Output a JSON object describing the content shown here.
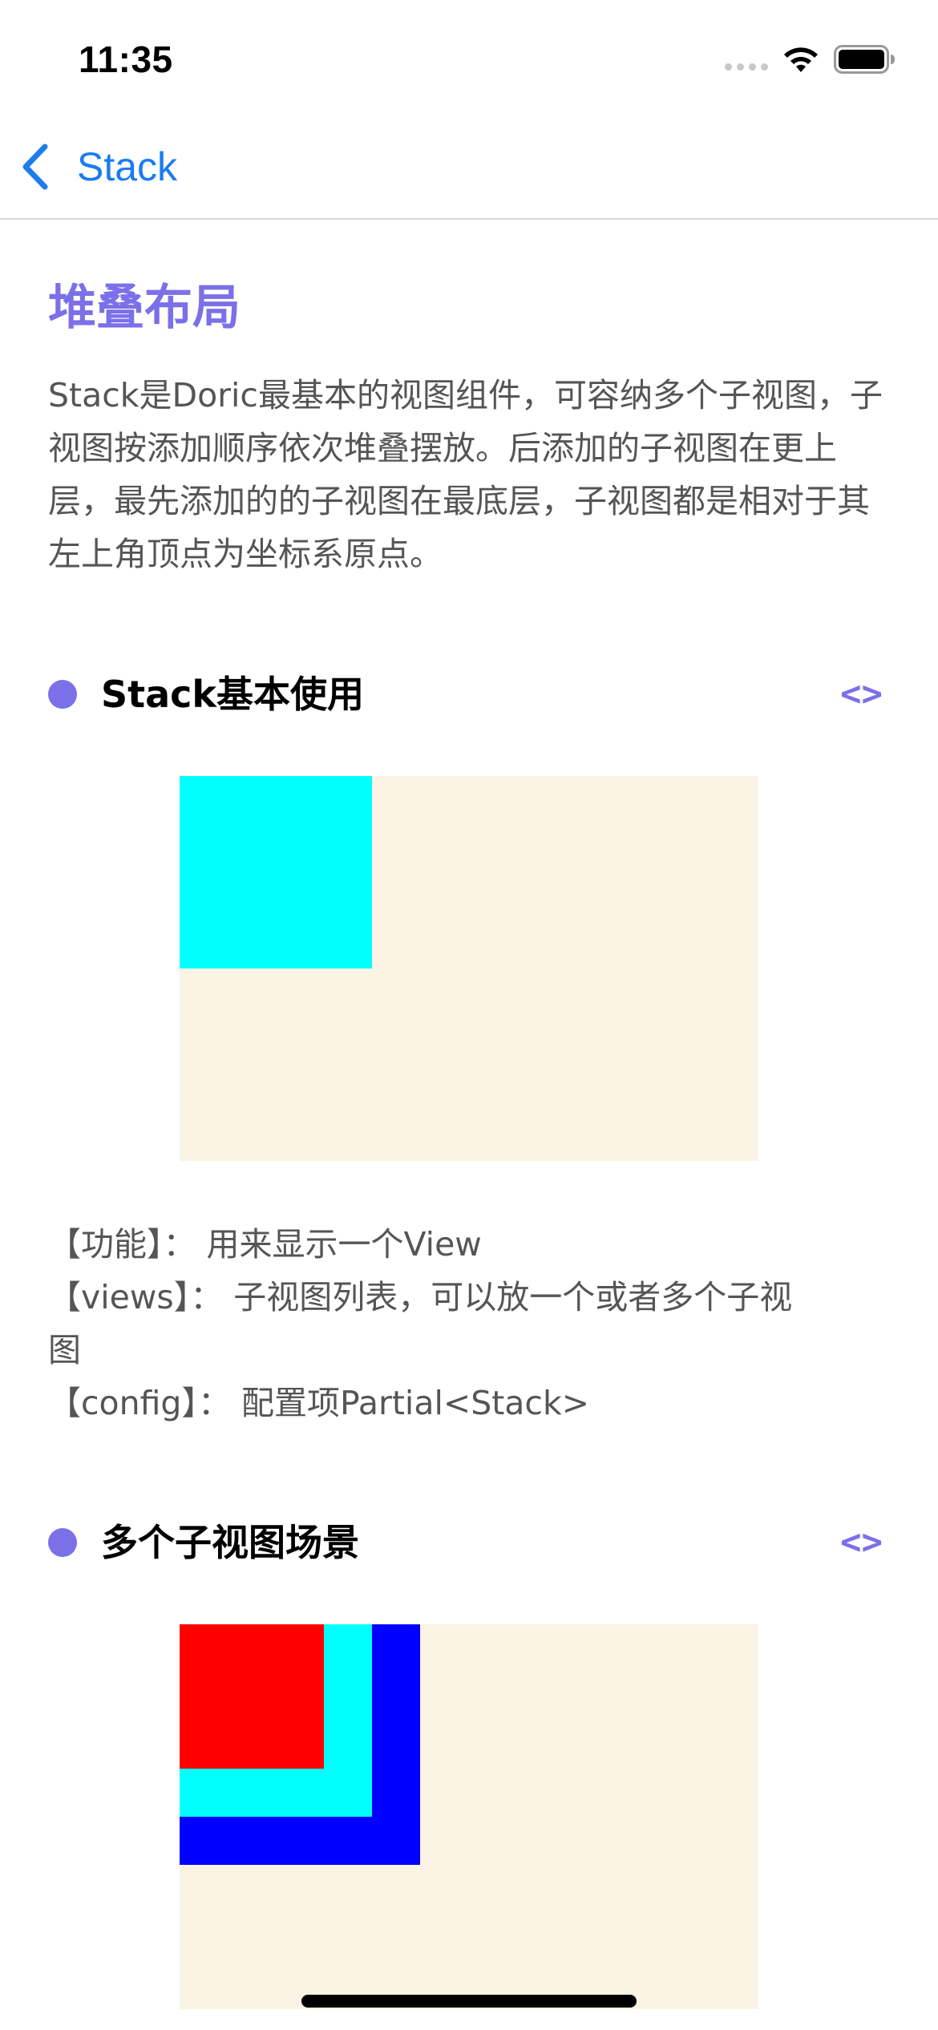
{
  "status_bar": {
    "time": "11:35"
  },
  "nav": {
    "back_label": "Stack"
  },
  "page": {
    "title": "堆叠布局",
    "description": "Stack是Doric最基本的视图组件，可容纳多个子视图，子视图按添加顺序依次堆叠摆放。后添加的子视图在更上层，最先添加的的子视图在最底层，子视图都是相对于其左上角顶点为坐标系原点。"
  },
  "sections": [
    {
      "title": "Stack基本使用",
      "code_toggle": "<>",
      "doc": [
        "【功能】： 用来显示一个View",
        "【views】： 子视图列表，可以放一个或者多个子视",
        "图",
        "【config】：  配置项Partial<Stack>"
      ]
    },
    {
      "title": "多个子视图场景",
      "code_toggle": "<>"
    }
  ],
  "colors": {
    "accent": "#7b70e8",
    "link_blue": "#1c7cf0",
    "stack_background": "#fbf3e4",
    "child_cyan": "#00ffff",
    "child_red": "#ff0000",
    "child_blue": "#0000ff"
  }
}
